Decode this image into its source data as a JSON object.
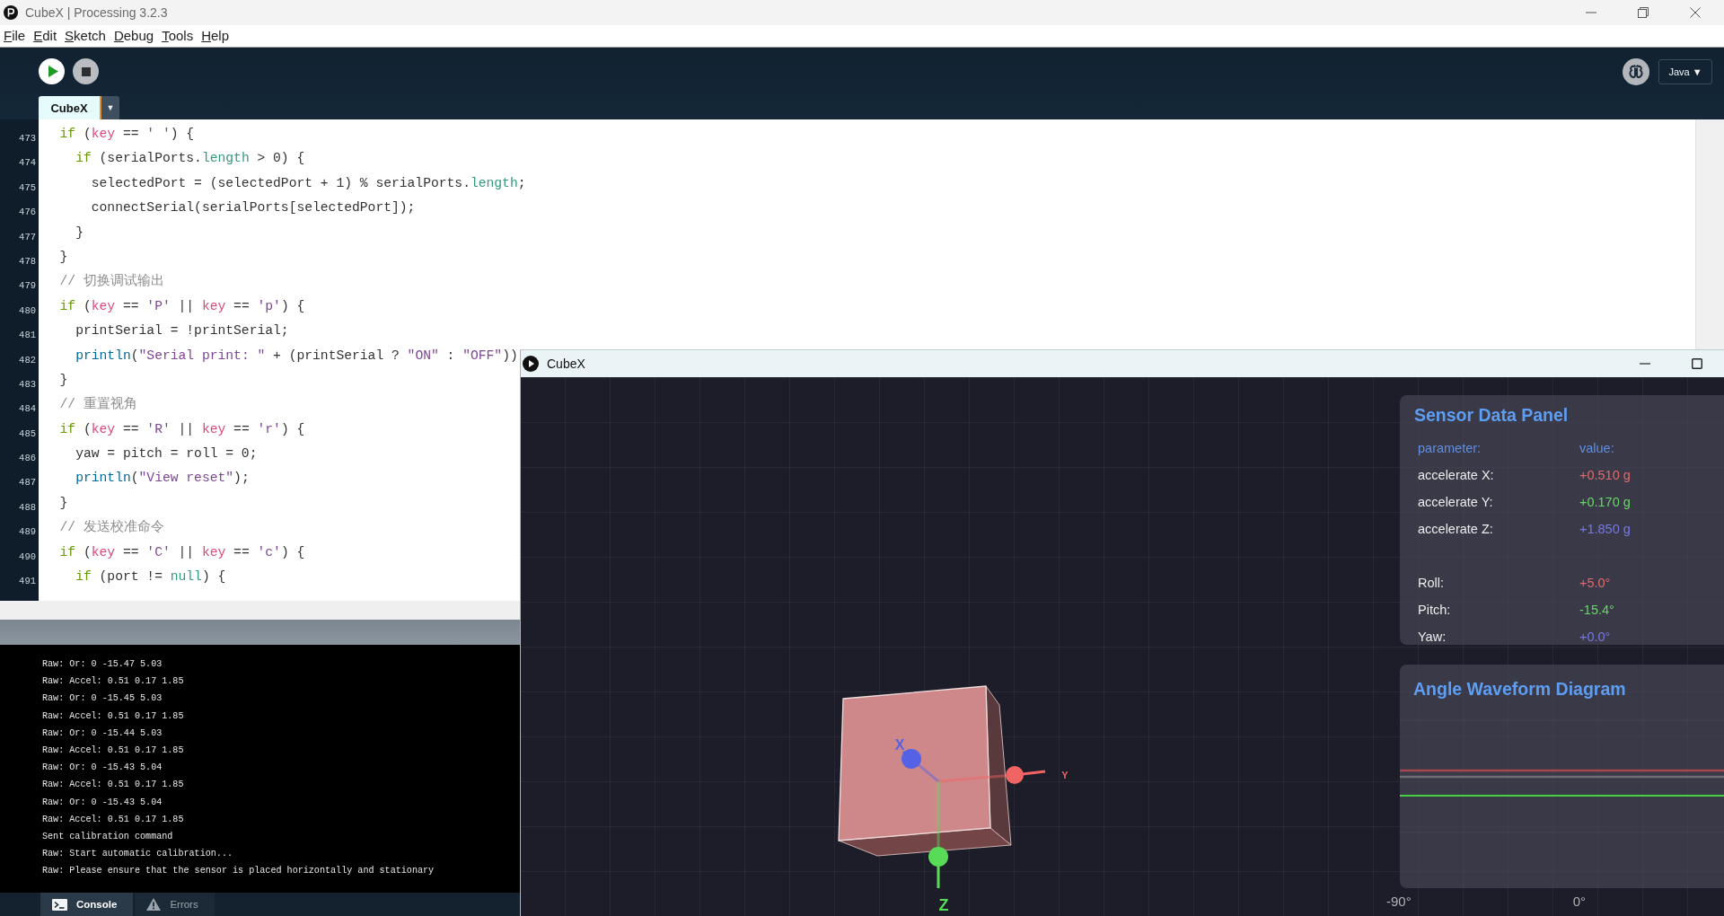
{
  "window": {
    "title": "CubeX | Processing 3.2.3"
  },
  "menu": [
    "File",
    "Edit",
    "Sketch",
    "Debug",
    "Tools",
    "Help"
  ],
  "toolbar": {
    "mode": {
      "label": "Java",
      "caret": "▼"
    }
  },
  "tabs": [
    {
      "label": "CubeX",
      "selected": true
    }
  ],
  "tab_menu": {
    "caret": "▼"
  },
  "editor": {
    "lines": [
      {
        "number": "473",
        "segments": [
          {
            "text": "  if",
            "kind": "keyword"
          },
          {
            "text": " (",
            "kind": "plain"
          },
          {
            "text": "key",
            "kind": "variable"
          },
          {
            "text": " == ",
            "kind": "plain"
          },
          {
            "text": "' '",
            "kind": "string"
          },
          {
            "text": ") {",
            "kind": "plain"
          }
        ]
      },
      {
        "number": "474",
        "segments": [
          {
            "text": "    if",
            "kind": "keyword"
          },
          {
            "text": " (serialPorts.",
            "kind": "plain"
          },
          {
            "text": "length",
            "kind": "field"
          },
          {
            "text": " > 0) {",
            "kind": "plain"
          }
        ]
      },
      {
        "number": "475",
        "segments": [
          {
            "text": "      selectedPort = (selectedPort + 1) % serialPorts.",
            "kind": "plain"
          },
          {
            "text": "length",
            "kind": "field"
          },
          {
            "text": ";",
            "kind": "plain"
          }
        ]
      },
      {
        "number": "476",
        "segments": [
          {
            "text": "      connectSerial(serialPorts[selectedPort]);",
            "kind": "plain"
          }
        ]
      },
      {
        "number": "477",
        "segments": [
          {
            "text": "    }",
            "kind": "plain"
          }
        ]
      },
      {
        "number": "478",
        "segments": [
          {
            "text": "  }",
            "kind": "plain"
          }
        ]
      },
      {
        "number": "479",
        "segments": [
          {
            "text": "  // 切换调试输出",
            "kind": "comment"
          }
        ]
      },
      {
        "number": "480",
        "segments": [
          {
            "text": "  if",
            "kind": "keyword"
          },
          {
            "text": " (",
            "kind": "plain"
          },
          {
            "text": "key",
            "kind": "variable"
          },
          {
            "text": " == ",
            "kind": "plain"
          },
          {
            "text": "'P'",
            "kind": "string"
          },
          {
            "text": " || ",
            "kind": "plain"
          },
          {
            "text": "key",
            "kind": "variable"
          },
          {
            "text": " == ",
            "kind": "plain"
          },
          {
            "text": "'p'",
            "kind": "string"
          },
          {
            "text": ") {",
            "kind": "plain"
          }
        ]
      },
      {
        "number": "481",
        "segments": [
          {
            "text": "    printSerial = !printSerial;",
            "kind": "plain"
          }
        ]
      },
      {
        "number": "482",
        "segments": [
          {
            "text": "    println",
            "kind": "function"
          },
          {
            "text": "(",
            "kind": "plain"
          },
          {
            "text": "\"Serial print: \"",
            "kind": "string"
          },
          {
            "text": " + (printSerial ? ",
            "kind": "plain"
          },
          {
            "text": "\"ON\"",
            "kind": "string"
          },
          {
            "text": " : ",
            "kind": "plain"
          },
          {
            "text": "\"OFF\"",
            "kind": "string"
          },
          {
            "text": "))",
            "kind": "plain"
          }
        ]
      },
      {
        "number": "483",
        "segments": [
          {
            "text": "  }",
            "kind": "plain"
          }
        ]
      },
      {
        "number": "484",
        "segments": [
          {
            "text": "  // 重置视角",
            "kind": "comment"
          }
        ]
      },
      {
        "number": "485",
        "segments": [
          {
            "text": "  if",
            "kind": "keyword"
          },
          {
            "text": " (",
            "kind": "plain"
          },
          {
            "text": "key",
            "kind": "variable"
          },
          {
            "text": " == ",
            "kind": "plain"
          },
          {
            "text": "'R'",
            "kind": "string"
          },
          {
            "text": " || ",
            "kind": "plain"
          },
          {
            "text": "key",
            "kind": "variable"
          },
          {
            "text": " == ",
            "kind": "plain"
          },
          {
            "text": "'r'",
            "kind": "string"
          },
          {
            "text": ") {",
            "kind": "plain"
          }
        ]
      },
      {
        "number": "486",
        "segments": [
          {
            "text": "    yaw = pitch = roll = 0;",
            "kind": "plain"
          }
        ]
      },
      {
        "number": "487",
        "segments": [
          {
            "text": "    println",
            "kind": "function"
          },
          {
            "text": "(",
            "kind": "plain"
          },
          {
            "text": "\"View reset\"",
            "kind": "string"
          },
          {
            "text": ");",
            "kind": "plain"
          }
        ]
      },
      {
        "number": "488",
        "segments": [
          {
            "text": "  }",
            "kind": "plain"
          }
        ]
      },
      {
        "number": "489",
        "segments": [
          {
            "text": "  // 发送校准命令",
            "kind": "comment"
          }
        ]
      },
      {
        "number": "490",
        "segments": [
          {
            "text": "  if",
            "kind": "keyword"
          },
          {
            "text": " (",
            "kind": "plain"
          },
          {
            "text": "key",
            "kind": "variable"
          },
          {
            "text": " == ",
            "kind": "plain"
          },
          {
            "text": "'C'",
            "kind": "string"
          },
          {
            "text": " || ",
            "kind": "plain"
          },
          {
            "text": "key",
            "kind": "variable"
          },
          {
            "text": " == ",
            "kind": "plain"
          },
          {
            "text": "'c'",
            "kind": "string"
          },
          {
            "text": ") {",
            "kind": "plain"
          }
        ]
      },
      {
        "number": "491",
        "segments": [
          {
            "text": "    if",
            "kind": "keyword"
          },
          {
            "text": " (port != ",
            "kind": "plain"
          },
          {
            "text": "null",
            "kind": "literal"
          },
          {
            "text": ") {",
            "kind": "plain"
          }
        ]
      }
    ]
  },
  "console": {
    "lines": [
      "Raw: Or: 0 -15.47 5.03",
      "Raw: Accel: 0.51 0.17 1.85",
      "Raw: Or: 0 -15.45 5.03",
      "Raw: Accel: 0.51 0.17 1.85",
      "Raw: Or: 0 -15.44 5.03",
      "Raw: Accel: 0.51 0.17 1.85",
      "Raw: Or: 0 -15.43 5.04",
      "Raw: Accel: 0.51 0.17 1.85",
      "Raw: Or: 0 -15.43 5.04",
      "Raw: Accel: 0.51 0.17 1.85",
      "Sent calibration command",
      "Raw: Start automatic calibration...",
      "Raw: Please ensure that the sensor is placed horizontally and stationary"
    ]
  },
  "console_tabs": [
    {
      "label": "Console",
      "selected": true,
      "kind": "console"
    },
    {
      "label": "Errors",
      "selected": false,
      "kind": "errors"
    }
  ],
  "sketch_window": {
    "title": "CubeX",
    "axes": [
      {
        "label": "X",
        "color": "#5662e6"
      },
      {
        "label": "Y",
        "color": "#f06464"
      },
      {
        "label": "Z",
        "color": "#58dc58"
      }
    ],
    "sensor_panel": {
      "title": "Sensor Data Panel",
      "header": [
        "parameter:",
        "value:"
      ],
      "groups": [
        {
          "rows": [
            {
              "label": "accelerate X:",
              "value": "+0.510 g",
              "color": "#e46a6a"
            },
            {
              "label": "accelerate Y:",
              "value": "+0.170 g",
              "color": "#66d866"
            },
            {
              "label": "accelerate Z:",
              "value": "+1.850 g",
              "color": "#7878e6"
            }
          ]
        },
        {
          "rows": [
            {
              "label": "Roll:",
              "value": "+5.0°",
              "color": "#e46a6a"
            },
            {
              "label": "Pitch:",
              "value": "-15.4°",
              "color": "#66d866"
            },
            {
              "label": "Yaw:",
              "value": "+0.0°",
              "color": "#7878e6"
            }
          ]
        }
      ]
    },
    "waveform_panel": {
      "title": "Angle Waveform Diagram"
    },
    "scale_labels": [
      "-90°",
      "0°"
    ]
  }
}
